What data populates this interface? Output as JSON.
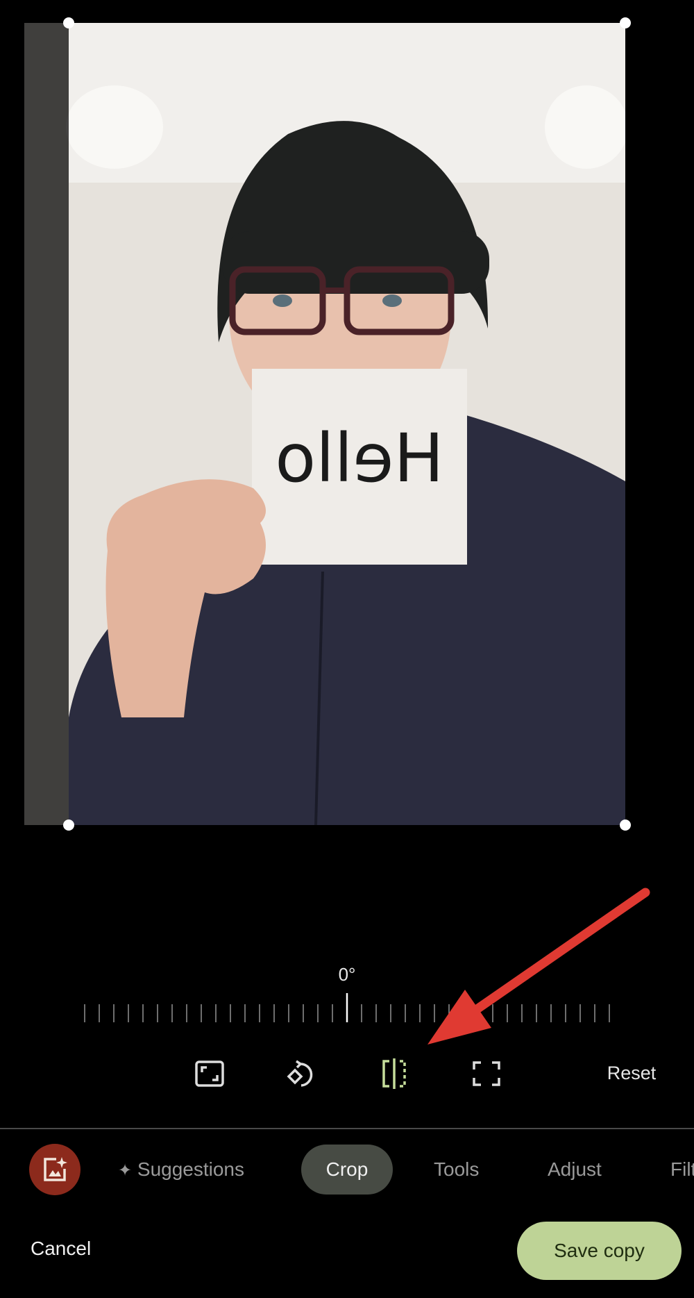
{
  "photo": {
    "sign_text": "Hello",
    "description_colors": {
      "wall": "#e9e5df",
      "hoodie": "#2a2b3d",
      "beanie": "#1d1f1e"
    }
  },
  "crop": {
    "rotation_label": "0°",
    "rotation_degrees": 0,
    "tools": [
      {
        "name": "aspect-ratio-icon",
        "active": false
      },
      {
        "name": "rotate-icon",
        "active": false
      },
      {
        "name": "flip-icon",
        "active": true
      },
      {
        "name": "free-crop-icon",
        "active": false
      }
    ],
    "reset_label": "Reset"
  },
  "tabs": {
    "suggestions": "Suggestions",
    "crop": "Crop",
    "tools": "Tools",
    "adjust": "Adjust",
    "filters": "Filt"
  },
  "footer": {
    "cancel": "Cancel",
    "save": "Save copy"
  },
  "colors": {
    "accent": "#bed396",
    "active_icon": "#c5dd9a",
    "annotation_arrow": "#e03a32",
    "avatar_bg": "#8c2a1c"
  }
}
